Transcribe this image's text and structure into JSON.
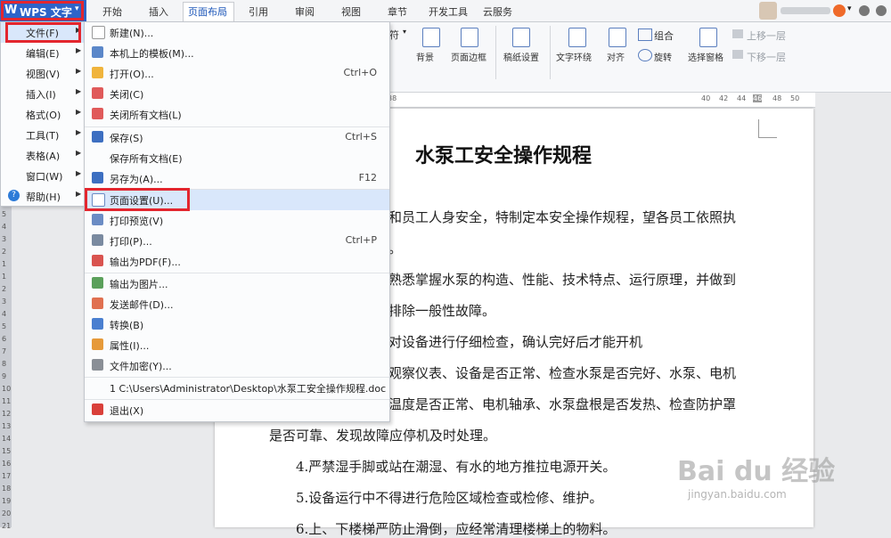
{
  "app": {
    "logo": "W",
    "title": "WPS 文字",
    "arrow": "▾"
  },
  "tabs": [
    "开始",
    "插入",
    "页面布局",
    "引用",
    "审阅",
    "视图",
    "章节",
    "开发工具",
    "云服务"
  ],
  "active_tab": "页面布局",
  "ribbon": {
    "partial": "符",
    "buttons": [
      "背景",
      "页面边框",
      "稿纸设置",
      "文字环绕",
      "对齐",
      "旋转",
      "选择窗格"
    ],
    "group_label": "组合",
    "up_label": "上移一层",
    "down_label": "下移一层"
  },
  "ruler_numbers": [
    "38",
    "40",
    "42",
    "44",
    "46",
    "48",
    "50"
  ],
  "vruler_numbers": [
    "5",
    "4",
    "3",
    "2",
    "1",
    "1",
    "2",
    "3",
    "4",
    "5",
    "6",
    "7",
    "8",
    "9",
    "10",
    "11",
    "12",
    "13",
    "14",
    "15",
    "16",
    "17",
    "18",
    "19",
    "20",
    "21"
  ],
  "document": {
    "title": "水泵工安全操作规程",
    "lines": [
      "产和员工人身安全，特制定本安全操作规程，望各员工依照执",
      "行。",
      "须熟悉掌握水泵的构造、性能、技术特点、运行原理，并做到",
      "会排除一般性故障。",
      "须对设备进行仔细检查，确认完好后才能开机",
      "行观察仪表、设备是否正常、检查水泵是否完好、水泵、电机",
      "承温度是否正常、电机轴承、水泵盘根是否发热、检查防护罩",
      "是否可靠、发现故障应停机及时处理。",
      "4.严禁湿手脚或站在潮湿、有水的地方推拉电源开关。",
      "5.设备运行中不得进行危险区域检查或检修、维护。",
      "6.上、下楼梯严防止滑倒，应经常清理楼梯上的物料。"
    ]
  },
  "main_menu": [
    {
      "label": "文件(F)",
      "icon": ""
    },
    {
      "label": "编辑(E)",
      "icon": ""
    },
    {
      "label": "视图(V)",
      "icon": ""
    },
    {
      "label": "插入(I)",
      "icon": ""
    },
    {
      "label": "格式(O)",
      "icon": ""
    },
    {
      "label": "工具(T)",
      "icon": ""
    },
    {
      "label": "表格(A)",
      "icon": ""
    },
    {
      "label": "窗口(W)",
      "icon": ""
    },
    {
      "label": "帮助(H)",
      "icon": "help-icon"
    }
  ],
  "file_menu": [
    {
      "label": "新建(N)...",
      "shortcut": "",
      "icon": "new-file-icon"
    },
    {
      "label": "本机上的模板(M)...",
      "shortcut": "",
      "icon": "template-icon"
    },
    {
      "label": "打开(O)...",
      "shortcut": "Ctrl+O",
      "icon": "folder-open-icon"
    },
    {
      "label": "关闭(C)",
      "shortcut": "",
      "icon": "close-doc-icon"
    },
    {
      "label": "关闭所有文档(L)",
      "shortcut": "",
      "icon": "close-all-icon"
    },
    {
      "label": "保存(S)",
      "shortcut": "Ctrl+S",
      "icon": "save-icon"
    },
    {
      "label": "保存所有文档(E)",
      "shortcut": "",
      "icon": ""
    },
    {
      "label": "另存为(A)...",
      "shortcut": "F12",
      "icon": "save-as-icon"
    },
    {
      "label": "页面设置(U)...",
      "shortcut": "",
      "icon": "page-setup-icon"
    },
    {
      "label": "打印预览(V)",
      "shortcut": "",
      "icon": "print-preview-icon"
    },
    {
      "label": "打印(P)...",
      "shortcut": "Ctrl+P",
      "icon": "print-icon"
    },
    {
      "label": "输出为PDF(F)...",
      "shortcut": "",
      "icon": "pdf-icon"
    },
    {
      "label": "输出为图片...",
      "shortcut": "",
      "icon": "export-image-icon"
    },
    {
      "label": "发送邮件(D)...",
      "shortcut": "",
      "icon": "mail-icon"
    },
    {
      "label": "转换(B)",
      "shortcut": "",
      "icon": "convert-icon"
    },
    {
      "label": "属性(I)...",
      "shortcut": "",
      "icon": "properties-icon"
    },
    {
      "label": "文件加密(Y)...",
      "shortcut": "",
      "icon": "encrypt-icon"
    },
    {
      "label": "1 C:\\Users\\Administrator\\Desktop\\水泵工安全操作规程.doc",
      "shortcut": "",
      "icon": ""
    },
    {
      "label": "退出(X)",
      "shortcut": "",
      "icon": "exit-icon"
    }
  ],
  "watermark": {
    "main": "Bai du 经验",
    "sub": "jingyan.baidu.com"
  },
  "colors": {
    "accent": "#2d64c8",
    "highlight": "#e3262e",
    "menu_hover": "#d9e7fb"
  }
}
